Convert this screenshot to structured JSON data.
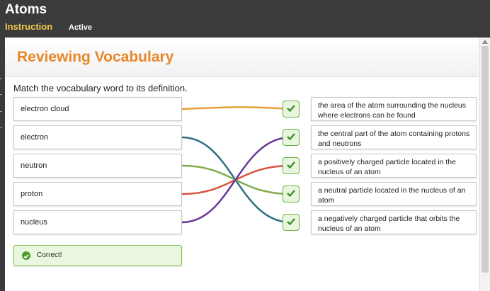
{
  "app": {
    "title": "Atoms"
  },
  "tabs": {
    "instruction": "Instruction",
    "active": "Active"
  },
  "panel": {
    "title": "Reviewing Vocabulary",
    "instruction": "Match the vocabulary word to its definition."
  },
  "terms": [
    "electron cloud",
    "electron",
    "neutron",
    "proton",
    "nucleus"
  ],
  "definitions": [
    "the area of the atom surrounding the nucleus where electrons can be found",
    "the central part of the atom containing protons and neutrons",
    "a positively charged particle located in the nucleus of an atom",
    "a neutral particle located in the nucleus of an atom",
    "a negatively charged particle that orbits the nucleus of an atom"
  ],
  "matches": [
    {
      "term": 0,
      "definition": 0,
      "color": "#e8a035"
    },
    {
      "term": 1,
      "definition": 4,
      "color": "#2f6f7f"
    },
    {
      "term": 2,
      "definition": 3,
      "color": "#7fae4a"
    },
    {
      "term": 3,
      "definition": 2,
      "color": "#d9533b"
    },
    {
      "term": 4,
      "definition": 1,
      "color": "#6a3a9a"
    }
  ],
  "feedback": {
    "text": "Correct!",
    "icon": "check-circle-icon"
  },
  "colors": {
    "accent": "#e8872a",
    "correct": "#6db33f",
    "header_bg": "#3b3b3b",
    "tab_highlight": "#f2c94c"
  }
}
